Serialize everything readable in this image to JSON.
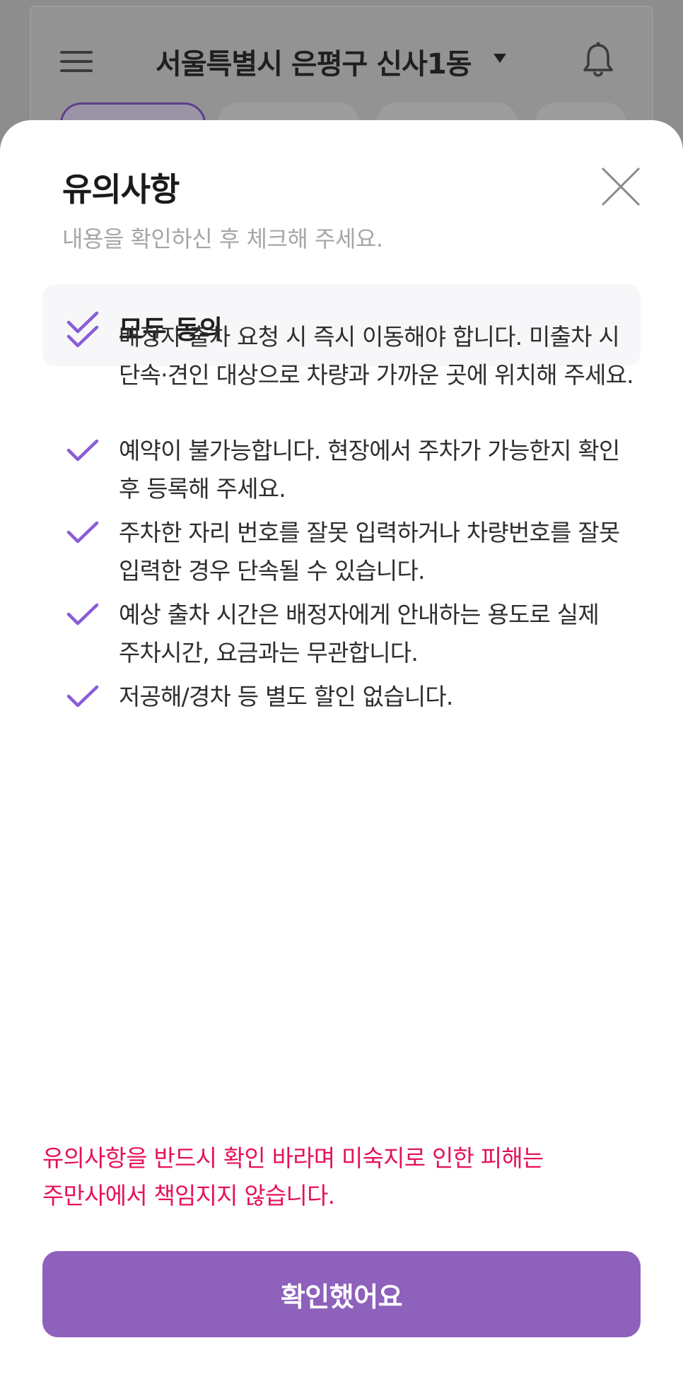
{
  "background": {
    "header": {
      "location": "서울특별시 은평구 신사1동"
    }
  },
  "sheet": {
    "title": "유의사항",
    "subtitle": "내용을 확인하신 후 체크해 주세요.",
    "agree_all": "모두 동의",
    "items": [
      {
        "text": "배정자 출차 요청 시 즉시 이동해야 합니다. 미출차 시 단속·견인 대상으로 차량과 가까운 곳에 위치해 주세요."
      },
      {
        "text": "예약이 불가능합니다. 현장에서 주차가 가능한지 확인 후 등록해 주세요."
      },
      {
        "text": "주차한 자리 번호를 잘못 입력하거나 차량번호를 잘못 입력한 경우 단속될 수 있습니다."
      },
      {
        "text": "예상 출차 시간은 배정자에게 안내하는 용도로 실제 주차시간, 요금과는 무관합니다."
      },
      {
        "text": "저공해/경차 등 별도 할인 없습니다."
      }
    ],
    "notice": "유의사항을 반드시 확인 바라며 미숙지로 인한 피해는 주만사에서 책임지지 않습니다.",
    "confirm_button": "확인했어요"
  },
  "colors": {
    "accent": "#8d61bc",
    "check": "#8a5cd6",
    "notice": "#e5125b"
  },
  "icons": {
    "menu": "hamburger-icon",
    "location_dropdown": "caret-down-icon",
    "notifications": "bell-icon",
    "close": "close-icon",
    "check": "check-icon"
  }
}
